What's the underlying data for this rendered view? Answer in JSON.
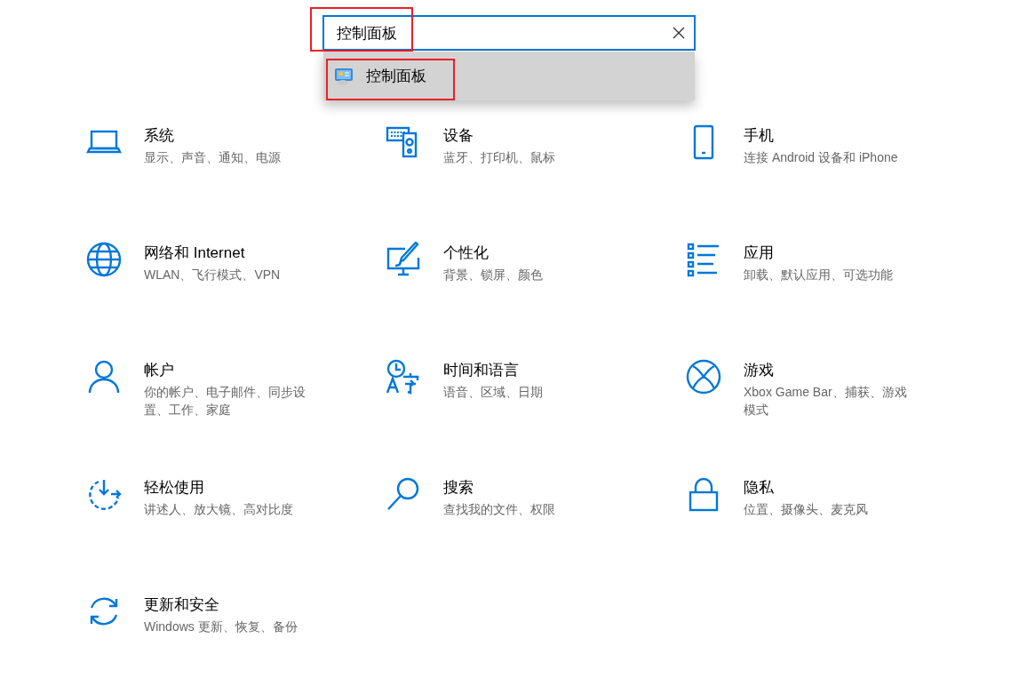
{
  "search": {
    "value": "控制面板",
    "highlighted": true
  },
  "suggestions": [
    {
      "label": "控制面板",
      "highlighted": true
    }
  ],
  "tiles": [
    {
      "kind": "laptop",
      "title": "系统",
      "subtitle": "显示、声音、通知、电源"
    },
    {
      "kind": "devices",
      "title": "设备",
      "subtitle": "蓝牙、打印机、鼠标"
    },
    {
      "kind": "phone",
      "title": "手机",
      "subtitle": "连接 Android 设备和 iPhone"
    },
    {
      "kind": "globe",
      "title": "网络和 Internet",
      "subtitle": "WLAN、飞行模式、VPN"
    },
    {
      "kind": "paint",
      "title": "个性化",
      "subtitle": "背景、锁屏、颜色"
    },
    {
      "kind": "apps",
      "title": "应用",
      "subtitle": "卸载、默认应用、可选功能"
    },
    {
      "kind": "person",
      "title": "帐户",
      "subtitle": "你的帐户、电子邮件、同步设置、工作、家庭"
    },
    {
      "kind": "time",
      "title": "时间和语言",
      "subtitle": "语音、区域、日期"
    },
    {
      "kind": "xbox",
      "title": "游戏",
      "subtitle": "Xbox Game Bar、捕获、游戏模式"
    },
    {
      "kind": "ease",
      "title": "轻松使用",
      "subtitle": "讲述人、放大镜、高对比度"
    },
    {
      "kind": "search",
      "title": "搜索",
      "subtitle": "查找我的文件、权限"
    },
    {
      "kind": "lock",
      "title": "隐私",
      "subtitle": "位置、摄像头、麦克风"
    },
    {
      "kind": "update",
      "title": "更新和安全",
      "subtitle": "Windows 更新、恢复、备份"
    }
  ]
}
